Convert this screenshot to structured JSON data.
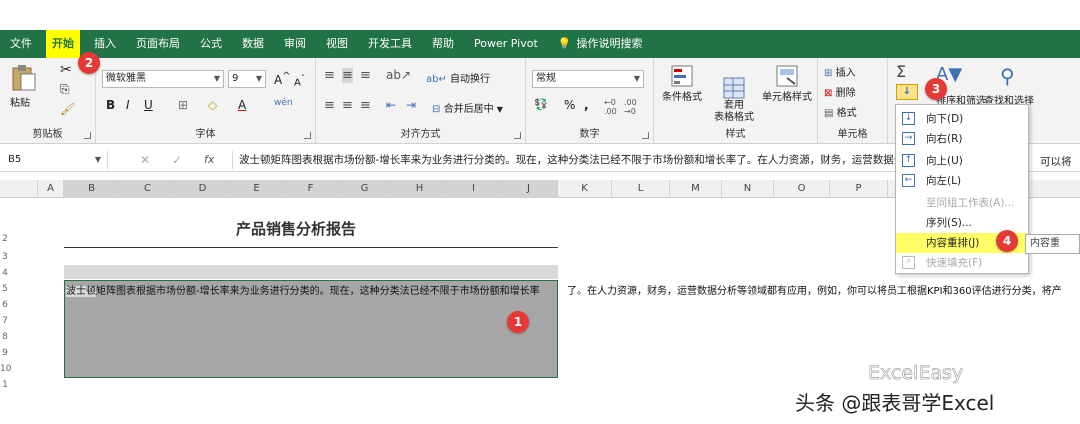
{
  "menubar": {
    "items": [
      "文件",
      "开始",
      "插入",
      "页面布局",
      "公式",
      "数据",
      "审阅",
      "视图",
      "开发工具",
      "帮助",
      "Power Pivot"
    ],
    "search_label": "操作说明搜索"
  },
  "ribbon": {
    "clipboard": {
      "label": "剪贴板",
      "paste": "粘贴"
    },
    "font": {
      "label": "字体",
      "name": "微软雅黑",
      "size": "9",
      "bold": "B",
      "italic": "I",
      "underline": "U",
      "grow": "A",
      "shrink": "A",
      "phonetic": "wén"
    },
    "alignment": {
      "label": "对齐方式",
      "wrap": "自动换行",
      "merge": "合并后居中"
    },
    "number": {
      "label": "数字",
      "format": "常规",
      "percent": "%",
      "comma": ","
    },
    "styles": {
      "label": "样式",
      "conditional": "条件格式",
      "table_format": "套用\n表格格式",
      "cell_styles": "单元格样式"
    },
    "cells": {
      "label": "单元格",
      "insert": "插入",
      "delete": "删除",
      "format": "格式"
    },
    "editing": {
      "sigma": "Σ",
      "sort_filter": "排序和筛选",
      "find_select": "查找和选择"
    }
  },
  "formula_bar": {
    "name_box": "B5",
    "content": "波士顿矩阵图表根据市场份额-增长率来为业务进行分类的。现在，这种分类法已经不限于市场份额和增长率了。在人力资源，财务，运营数据分析",
    "content_tail": "可以将"
  },
  "columns": [
    "A",
    "B",
    "C",
    "D",
    "E",
    "F",
    "G",
    "H",
    "I",
    "J",
    "K",
    "L",
    "M",
    "N",
    "O",
    "P"
  ],
  "rows": [
    "2",
    "3",
    "4",
    "5",
    "6",
    "7",
    "8",
    "9",
    "10",
    "1"
  ],
  "sheet": {
    "title": "产品销售分析报告",
    "cell_text_part1": "波士顿",
    "cell_text_part2": "矩阵图表根据市场份额-增长率来为业务进行分类的。现在，这种分类法已经不限于市场份额和增长率",
    "cell_text_part3": "了。在人力资源，财务，运营数据分析等领域都有应用，例如，你可以将员工根据KPI和360评估进行分类，将产"
  },
  "fill_menu": {
    "items": [
      {
        "label": "向下(D)",
        "icon": "↓",
        "disabled": false
      },
      {
        "label": "向右(R)",
        "icon": "→",
        "disabled": false
      },
      {
        "label": "向上(U)",
        "icon": "↑",
        "disabled": false
      },
      {
        "label": "向左(L)",
        "icon": "←",
        "disabled": false
      },
      {
        "label": "至同组工作表(A)...",
        "icon": "",
        "disabled": true
      },
      {
        "label": "序列(S)...",
        "icon": "",
        "disabled": false
      },
      {
        "label": "内容重排(J)",
        "icon": "",
        "disabled": false
      },
      {
        "label": "快速填充(F)",
        "icon": "⚡",
        "disabled": true
      }
    ],
    "tooltip": "内容重"
  },
  "badges": [
    "1",
    "2",
    "3",
    "4"
  ],
  "watermark": "ExcelEasy",
  "caption": "头条 @跟表哥学Excel",
  "colors": {
    "excel_green": "#217346",
    "badge_red": "#e53935",
    "highlight_yellow": "#ffff00"
  }
}
